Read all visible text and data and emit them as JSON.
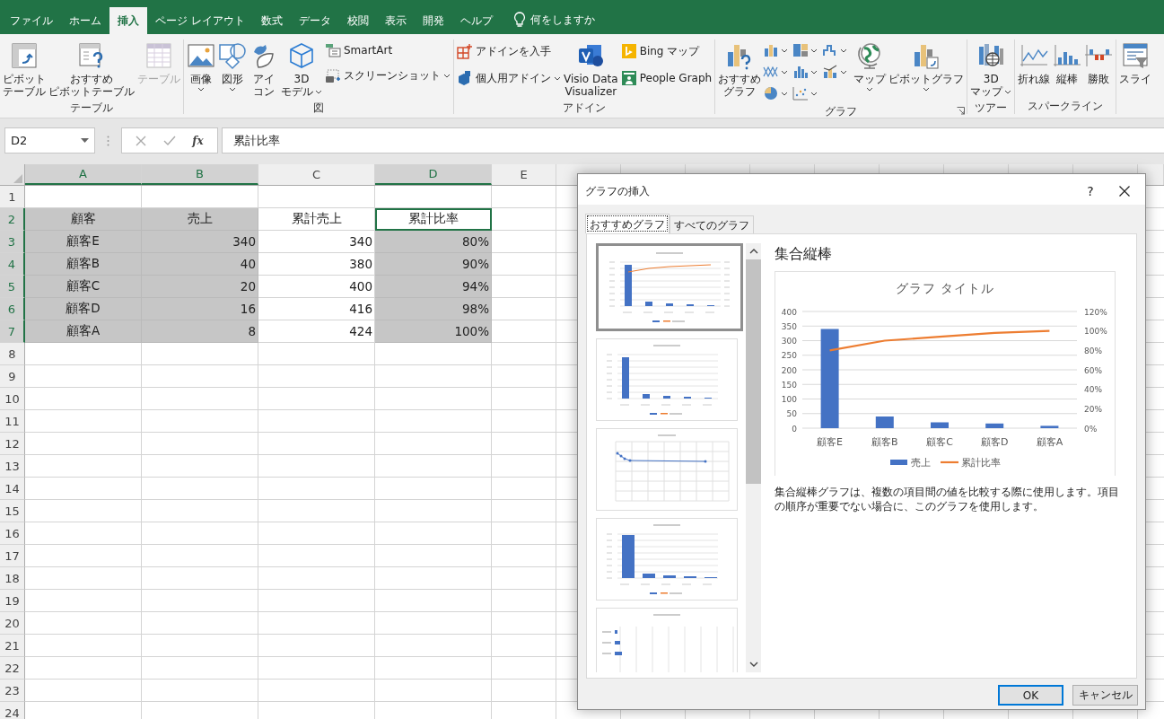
{
  "ribbon_tabs": [
    {
      "label": "ファイル",
      "selected": false
    },
    {
      "label": "ホーム",
      "selected": false
    },
    {
      "label": "挿入",
      "selected": true
    },
    {
      "label": "ページ レイアウト",
      "selected": false
    },
    {
      "label": "数式",
      "selected": false
    },
    {
      "label": "データ",
      "selected": false
    },
    {
      "label": "校閲",
      "selected": false
    },
    {
      "label": "表示",
      "selected": false
    },
    {
      "label": "開発",
      "selected": false
    },
    {
      "label": "ヘルプ",
      "selected": false
    }
  ],
  "tell_me": "何をしますか",
  "ribbon": {
    "groups": [
      {
        "label": "テーブル",
        "buttons": [
          {
            "lines": [
              "ピボット",
              "テーブル"
            ],
            "disabled": false
          },
          {
            "lines": [
              "おすすめ",
              "ピボットテーブル"
            ],
            "disabled": false
          },
          {
            "lines": [
              "テーブル"
            ],
            "disabled": true
          }
        ]
      },
      {
        "label": "図",
        "buttons": [
          {
            "lines": [
              "画像"
            ]
          },
          {
            "lines": [
              "図形"
            ]
          },
          {
            "lines": [
              "アイ",
              "コン"
            ]
          },
          {
            "lines": [
              "3D",
              "モデル"
            ]
          },
          {
            "lines": [
              "SmartArt"
            ]
          },
          {
            "lines": [
              "スクリーンショット"
            ]
          }
        ]
      },
      {
        "label": "アドイン",
        "buttons": [
          {
            "lines": [
              "アドインを入手"
            ]
          },
          {
            "lines": [
              "個人用アドイン"
            ]
          },
          {
            "lines": [
              "Visio Data",
              "Visualizer"
            ]
          },
          {
            "lines": [
              "Bing マップ"
            ]
          },
          {
            "lines": [
              "People Graph"
            ]
          }
        ]
      },
      {
        "label": "グラフ",
        "buttons": [
          {
            "lines": [
              "おすすめ",
              "グラフ"
            ]
          },
          {
            "lines": [
              "マップ"
            ]
          },
          {
            "lines": [
              "ピボットグラフ"
            ]
          }
        ]
      },
      {
        "label": "ツアー",
        "buttons": [
          {
            "lines": [
              "3D",
              "マップ"
            ]
          }
        ]
      },
      {
        "label": "スパークライン",
        "buttons": [
          {
            "lines": [
              "折れ線"
            ]
          },
          {
            "lines": [
              "縦棒"
            ]
          },
          {
            "lines": [
              "勝敗"
            ]
          }
        ]
      },
      {
        "buttons": [
          {
            "lines": [
              "スライ"
            ]
          }
        ]
      }
    ]
  },
  "formula_bar": {
    "name_box": "D2",
    "function_label": "fx",
    "value": "累計比率"
  },
  "sheet": {
    "columns": [
      {
        "label": "A",
        "selected": true
      },
      {
        "label": "B",
        "selected": true
      },
      {
        "label": "C",
        "selected": false
      },
      {
        "label": "D",
        "selected": true
      },
      {
        "label": "E",
        "selected": false
      }
    ],
    "rows": [
      {
        "label": "1",
        "selected": false
      },
      {
        "label": "2",
        "selected": true,
        "cells": [
          {
            "text": "顧客",
            "selected": true,
            "active": false
          },
          {
            "text": "売上",
            "selected": true,
            "active": false
          },
          {
            "text": "累計売上",
            "selected": false,
            "active": false
          },
          {
            "text": "累計比率",
            "selected": false,
            "active": true
          }
        ]
      },
      {
        "label": "3",
        "selected": true,
        "cells": [
          {
            "text": "顧客E",
            "selected": true,
            "active": false
          },
          {
            "text": "340",
            "selected": true,
            "active": false
          },
          {
            "text": "340",
            "selected": false,
            "active": false
          },
          {
            "text": "80%",
            "selected": true,
            "active": false
          }
        ]
      },
      {
        "label": "4",
        "selected": true,
        "cells": [
          {
            "text": "顧客B",
            "selected": true,
            "active": false
          },
          {
            "text": "40",
            "selected": true,
            "active": false
          },
          {
            "text": "380",
            "selected": false,
            "active": false
          },
          {
            "text": "90%",
            "selected": true,
            "active": false
          }
        ]
      },
      {
        "label": "5",
        "selected": true,
        "cells": [
          {
            "text": "顧客C",
            "selected": true,
            "active": false
          },
          {
            "text": "20",
            "selected": true,
            "active": false
          },
          {
            "text": "400",
            "selected": false,
            "active": false
          },
          {
            "text": "94%",
            "selected": true,
            "active": false
          }
        ]
      },
      {
        "label": "6",
        "selected": true,
        "cells": [
          {
            "text": "顧客D",
            "selected": true,
            "active": false
          },
          {
            "text": "16",
            "selected": true,
            "active": false
          },
          {
            "text": "416",
            "selected": false,
            "active": false
          },
          {
            "text": "98%",
            "selected": true,
            "active": false
          }
        ]
      },
      {
        "label": "7",
        "selected": true,
        "cells": [
          {
            "text": "顧客A",
            "selected": true,
            "active": false
          },
          {
            "text": "8",
            "selected": true,
            "active": false
          },
          {
            "text": "424",
            "selected": false,
            "active": false
          },
          {
            "text": "100%",
            "selected": true,
            "active": false
          }
        ]
      },
      {
        "label": "8",
        "selected": false
      },
      {
        "label": "9",
        "selected": false
      },
      {
        "label": "10",
        "selected": false
      },
      {
        "label": "11",
        "selected": false
      },
      {
        "label": "12",
        "selected": false
      },
      {
        "label": "13",
        "selected": false
      },
      {
        "label": "14",
        "selected": false
      },
      {
        "label": "15",
        "selected": false
      },
      {
        "label": "16",
        "selected": false
      },
      {
        "label": "17",
        "selected": false
      },
      {
        "label": "18",
        "selected": false
      },
      {
        "label": "19",
        "selected": false
      },
      {
        "label": "20",
        "selected": false
      },
      {
        "label": "21",
        "selected": false
      },
      {
        "label": "22",
        "selected": false
      },
      {
        "label": "23",
        "selected": false
      },
      {
        "label": "24",
        "selected": false
      }
    ]
  },
  "dialog": {
    "title": "グラフの挿入",
    "help": "?",
    "tabs": [
      {
        "label": "おすすめグラフ",
        "selected": true
      },
      {
        "label": "すべてのグラフ",
        "selected": false
      }
    ],
    "thumbnails": [
      {
        "kind": "combo",
        "selected": true
      },
      {
        "kind": "column",
        "selected": false
      },
      {
        "kind": "scatter",
        "selected": false
      },
      {
        "kind": "stacked",
        "selected": false
      },
      {
        "kind": "bar",
        "selected": false
      }
    ],
    "preview": {
      "heading": "集合縦棒",
      "chart_data": {
        "type": "bar",
        "title": "グラフ タイトル",
        "categories": [
          "顧客E",
          "顧客B",
          "顧客C",
          "顧客D",
          "顧客A"
        ],
        "series": [
          {
            "name": "売上",
            "type": "bar",
            "color": "#4472c4",
            "values": [
              340,
              40,
              20,
              16,
              8
            ]
          },
          {
            "name": "累計比率",
            "type": "line",
            "axis": "y2",
            "color": "#ed7d31",
            "values": [
              80,
              90,
              94,
              98,
              100
            ]
          }
        ],
        "ylim": [
          0,
          400
        ],
        "yticks": [
          0,
          50,
          100,
          150,
          200,
          250,
          300,
          350,
          400
        ],
        "y2lim": [
          0,
          120
        ],
        "y2ticks": [
          {
            "value": 0,
            "label": "0%"
          },
          {
            "value": 20,
            "label": "20%"
          },
          {
            "value": 40,
            "label": "40%"
          },
          {
            "value": 60,
            "label": "60%"
          },
          {
            "value": 80,
            "label": "80%"
          },
          {
            "value": 100,
            "label": "100%"
          },
          {
            "value": 120,
            "label": "120%"
          }
        ],
        "grid": true,
        "legend": true
      },
      "description": "集合縦棒グラフは、複数の項目間の値を比較する際に使用します。項目の順序が重要でない場合に、このグラフを使用します。"
    },
    "buttons": [
      {
        "label": "OK",
        "default": true
      },
      {
        "label": "キャンセル",
        "default": false
      }
    ]
  }
}
